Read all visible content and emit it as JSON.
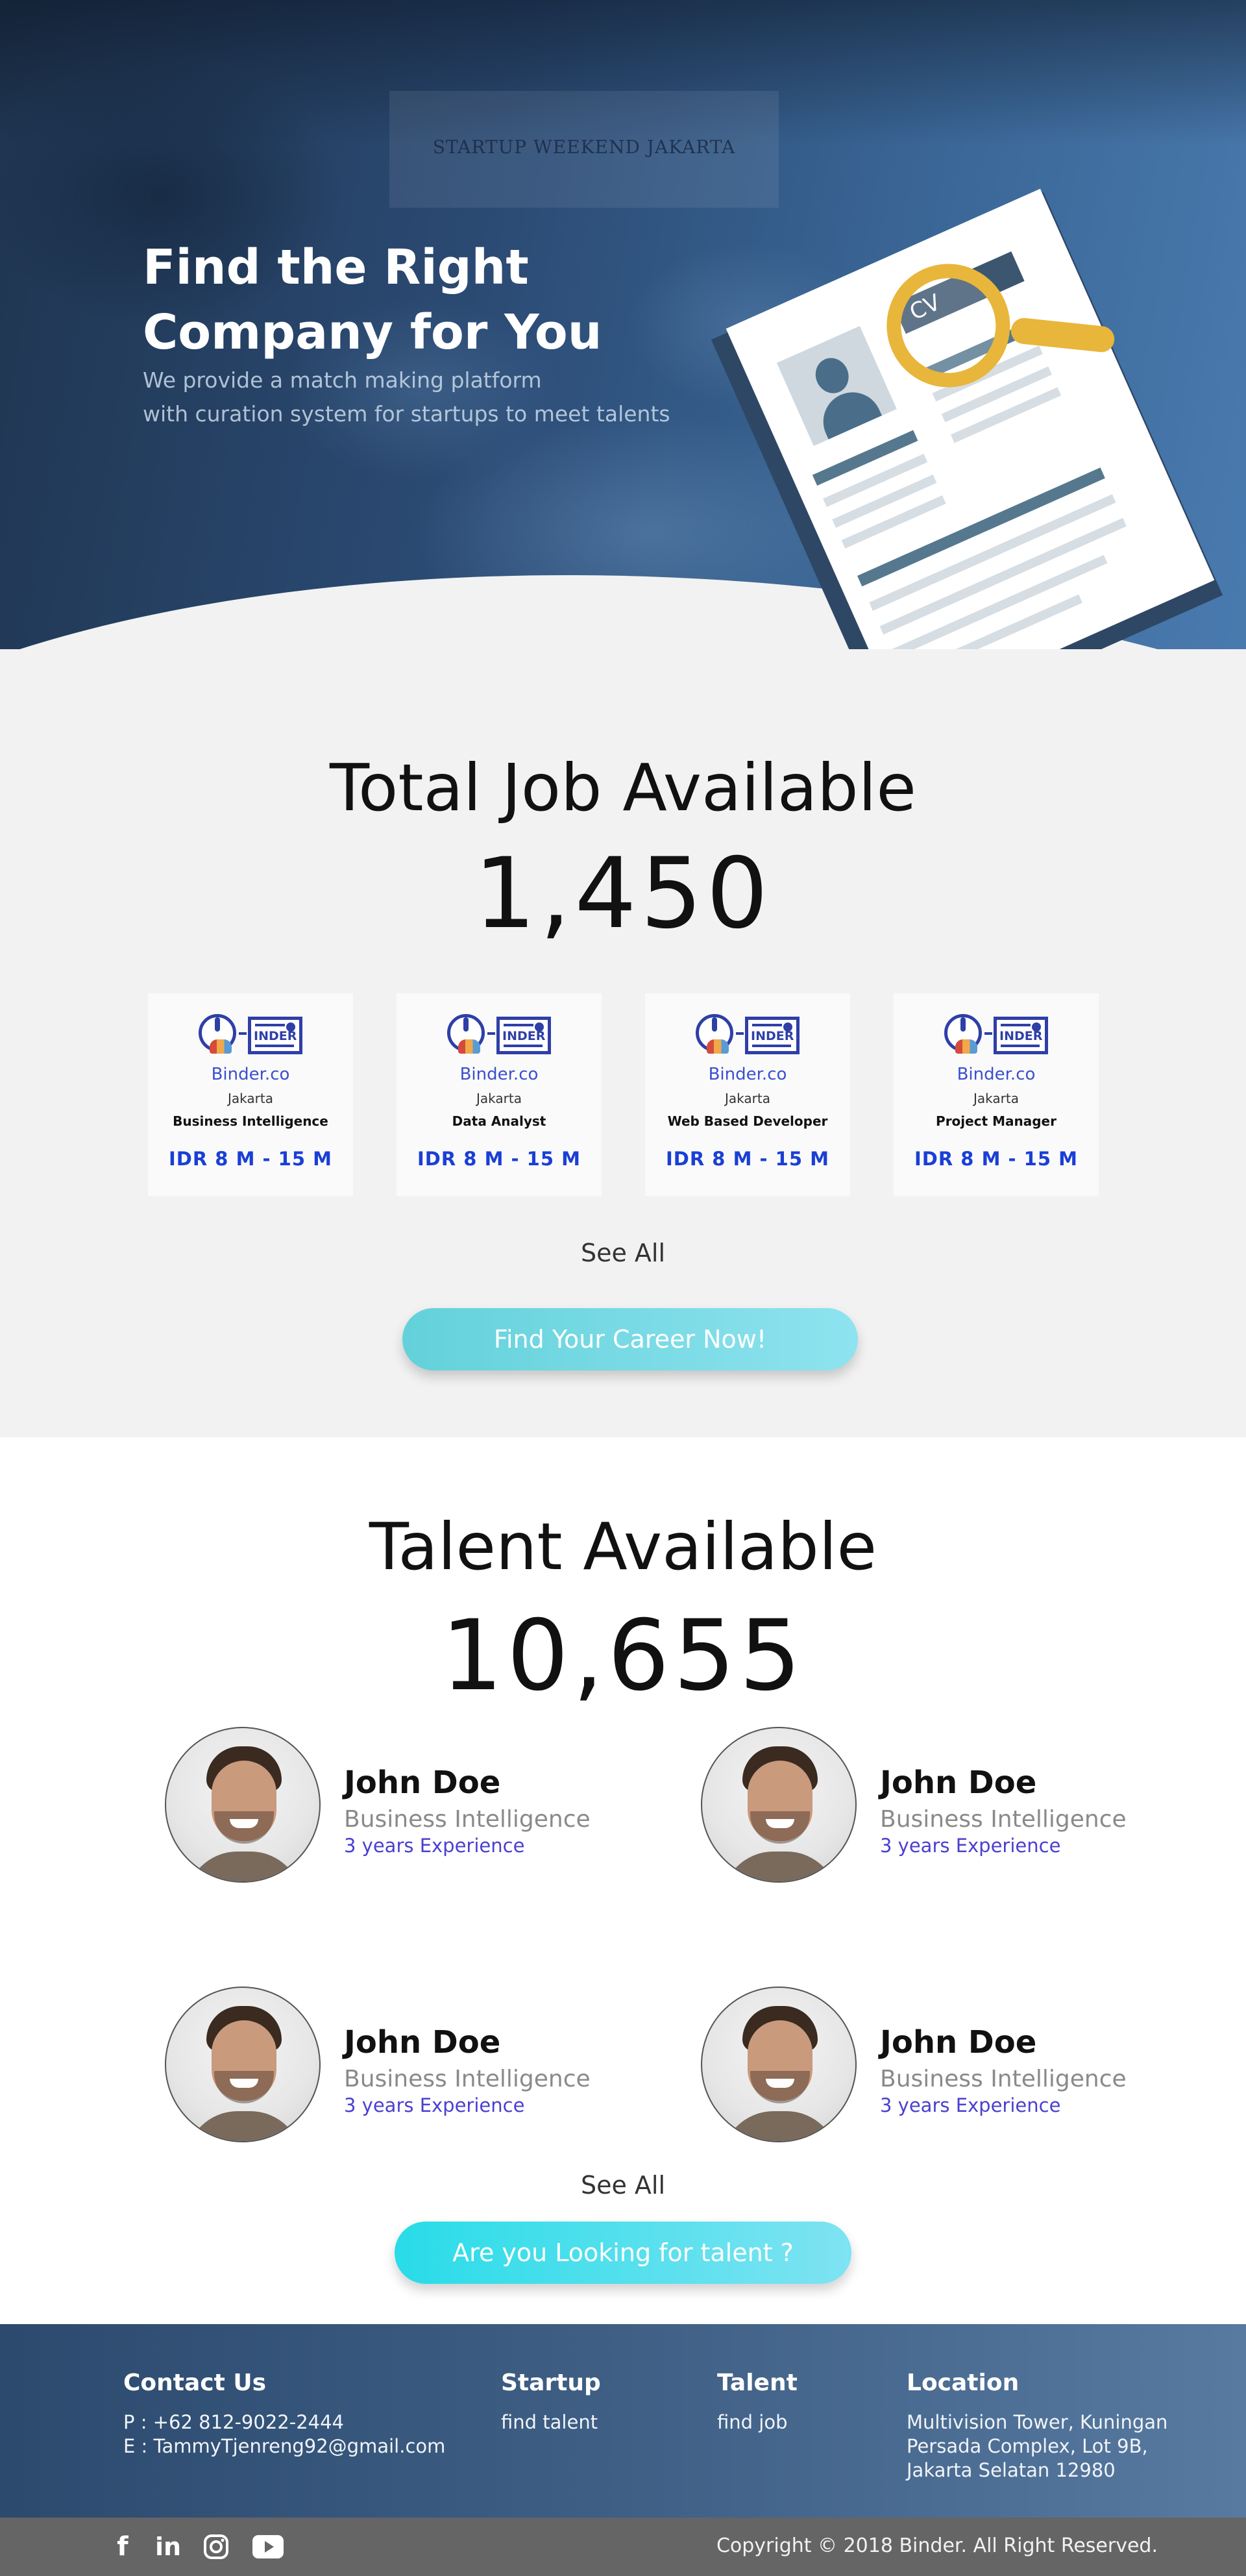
{
  "hero": {
    "title": "Find the Right Company for You",
    "subtitle_line1": "We provide a match making platform",
    "subtitle_line2": "with curation system for startups to meet talents",
    "photo_banner_text": "STARTUP WEEKEND JAKARTA",
    "cv_label": "CV"
  },
  "jobs": {
    "title": "Total Job Available",
    "count": "1,450",
    "cards": [
      {
        "company": "Binder.co",
        "city": "Jakarta",
        "role": "Business Intelligence",
        "salary": "IDR 8 M - 15 M",
        "logo_text": "INDER"
      },
      {
        "company": "Binder.co",
        "city": "Jakarta",
        "role": "Data Analyst",
        "salary": "IDR 8 M - 15 M",
        "logo_text": "INDER"
      },
      {
        "company": "Binder.co",
        "city": "Jakarta",
        "role": "Web Based Developer",
        "salary": "IDR 8 M - 15 M",
        "logo_text": "INDER"
      },
      {
        "company": "Binder.co",
        "city": "Jakarta",
        "role": "Project Manager",
        "salary": "IDR 8 M - 15 M",
        "logo_text": "INDER"
      }
    ],
    "see_all": "See All",
    "cta": "Find Your Career Now!"
  },
  "talent": {
    "title": "Talent Available",
    "count": "10,655",
    "people": [
      {
        "name": "John Doe",
        "role": "Business Intelligence",
        "experience": "3 years Experience"
      },
      {
        "name": "John Doe",
        "role": "Business Intelligence",
        "experience": "3 years Experience"
      },
      {
        "name": "John Doe",
        "role": "Business Intelligence",
        "experience": "3 years Experience"
      },
      {
        "name": "John Doe",
        "role": "Business Intelligence",
        "experience": "3 years Experience"
      }
    ],
    "see_all": "See All",
    "cta": "Are you Looking for talent ?"
  },
  "footer": {
    "contact": {
      "heading": "Contact Us",
      "phone": "P : +62 812-9022-2444",
      "email": "E : TammyTjenreng92@gmail.com"
    },
    "startup": {
      "heading": "Startup",
      "link": "find talent"
    },
    "talent": {
      "heading": "Talent",
      "link": "find job"
    },
    "location": {
      "heading": "Location",
      "line1": "Multivision Tower, Kuningan",
      "line2": "Persada Complex, Lot 9B,",
      "line3": "Jakarta Selatan 12980"
    },
    "social_icons": [
      "facebook-icon",
      "linkedin-icon",
      "instagram-icon",
      "youtube-icon"
    ],
    "copyright": "Copyright © 2018 Binder. All Right Reserved."
  },
  "colors": {
    "hero_blue": "#2b4a73",
    "accent_blue": "#1a3fd6",
    "cta_cyan": "#63d1da",
    "footer_blue": "#3f5f85",
    "bottom_bar": "#656565",
    "cv_yellow": "#e8b63a"
  }
}
